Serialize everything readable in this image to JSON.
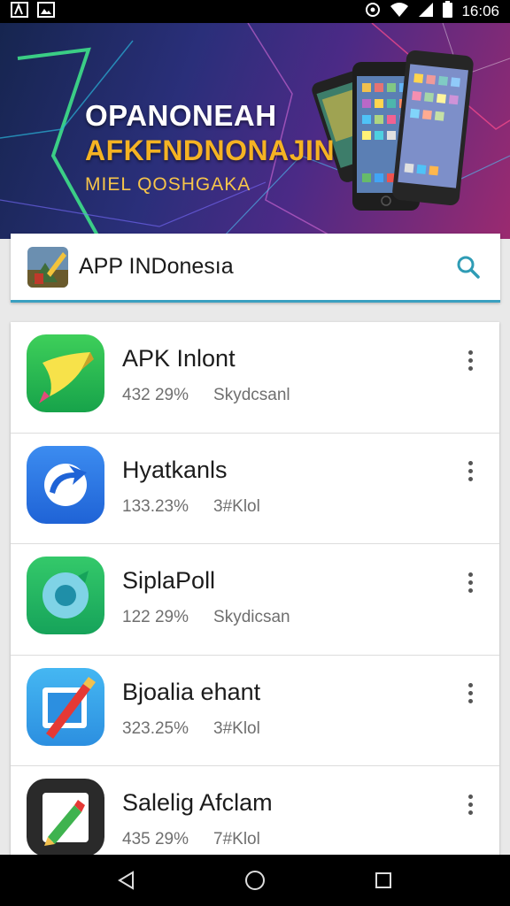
{
  "status_bar": {
    "time": "16:06",
    "left_icons": [
      "a-icon",
      "image-icon"
    ],
    "right_icons": [
      "hotspot-icon",
      "wifi-icon",
      "signal-icon",
      "battery-icon"
    ]
  },
  "banner": {
    "line1": "OPANONEAH",
    "line2": "AFKFNDNONAJIN",
    "line3": "MIEL QOSHGAKA",
    "colors": {
      "line1": "#ffffff",
      "line2": "#f5b323",
      "line3": "#f7c54a"
    }
  },
  "search_bar": {
    "title": "APP INDonesıa",
    "icon": "search-icon",
    "accent": "#3aa0c0"
  },
  "apps": [
    {
      "name": "APK Inlont",
      "stat1": "432 29%",
      "stat2": "Skydcsanl",
      "icon": "banana-pen-icon"
    },
    {
      "name": "Hyatkanls",
      "stat1": "133.23%",
      "stat2": "3#Klol",
      "icon": "refresh-arrow-icon"
    },
    {
      "name": "SiplaPoll",
      "stat1": "122 29%",
      "stat2": "Skydicsan",
      "icon": "ring-icon"
    },
    {
      "name": "Bjoalia ehant",
      "stat1": "323.25%",
      "stat2": "3#Klol",
      "icon": "brush-icon"
    },
    {
      "name": "Salelig Afclam",
      "stat1": "435 29%",
      "stat2": "7#Klol",
      "icon": "pencil-icon"
    }
  ],
  "nav_bar": {
    "buttons": [
      "back-icon",
      "home-icon",
      "recents-icon"
    ]
  }
}
